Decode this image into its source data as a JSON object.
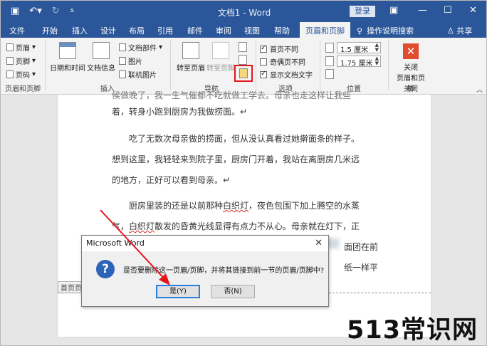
{
  "window": {
    "title": "文档1 - Word",
    "login": "登录"
  },
  "tabs": [
    "文件",
    "开始",
    "插入",
    "设计",
    "布局",
    "引用",
    "邮件",
    "审阅",
    "视图",
    "帮助",
    "页眉和页脚"
  ],
  "tell_me": "操作说明搜索",
  "share": "共享",
  "ribbon": {
    "hf_group": {
      "items": [
        "页眉",
        "页脚",
        "页码"
      ],
      "label": "页眉和页脚"
    },
    "insert_group": {
      "date_time": "日期和时间",
      "doc_info": "文档信息",
      "doc_parts": "文档部件",
      "picture": "图片",
      "online_picture": "联机图片",
      "label": "插入"
    },
    "nav_group": {
      "goto_header": "转至页眉",
      "goto_footer": "转至页脚",
      "label": "导航"
    },
    "options_group": {
      "diff_first": "首页不同",
      "diff_odd_even": "奇偶页不同",
      "show_text": "显示文档文字",
      "label": "选项"
    },
    "position_group": {
      "header_pos": "1.5 厘米",
      "footer_pos": "1.75 厘米",
      "label": "位置"
    },
    "close_group": {
      "close_line1": "关闭",
      "close_line2": "页眉和页脚",
      "label": "关闭"
    }
  },
  "document": {
    "cut_line": "候做晚了，我一生气催都不吃就做工学去。母亲也走这样让我些",
    "para1_line2": "着，转身小跑到厨房为我做捞面。↵",
    "para2_line1": "吃了无数次母亲做的捞面，但从没认真看过她擀面条的样子。",
    "para2_line2": "想到这里，我轻轻来到院子里，厨房门开着，我站在离厨房几米远",
    "para2_line3": "的地方，正好可以看到母亲。↵",
    "para3_line1_a": "厨房里装的还是以前那种",
    "para3_line1_squig": "白织灯",
    "para3_line1_b": "，夜色包围下加上腾空的水蒸",
    "para3_line2_a": "气，",
    "para3_line2_squig": "白织灯",
    "para3_line2_b": "散发的昏黄光线显得有点力不从心。母亲就在灯下，正",
    "para3_line3_tail": "面团在前",
    "para3_line4_tail": "纸一样平",
    "hf_tag": "首页页"
  },
  "dialog": {
    "title": "Microsoft Word",
    "message": "是否要删除这一页眉/页脚，并将其链接到前一节的页眉/页脚中?",
    "yes": "是(Y)",
    "no": "否(N)"
  },
  "watermark": "513常识网",
  "colors": {
    "titlebar": "#2b579a",
    "highlight": "#e5151c",
    "close_red": "#e04c2e"
  }
}
